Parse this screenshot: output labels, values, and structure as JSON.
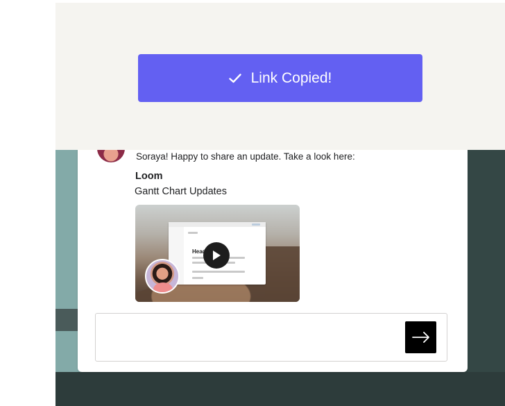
{
  "toast": {
    "icon": "check-icon",
    "label": "Link Copied!",
    "color": "#6360f2"
  },
  "message": {
    "text": "Soraya! Happy to share an update. Take a look here:",
    "attachment": {
      "source": "Loom",
      "title": "Gantt Chart Updates",
      "thumbnail": {
        "screen_heading": "Head",
        "play_icon": "play-icon"
      }
    }
  },
  "reply": {
    "value": "",
    "send_icon": "arrow-right-icon"
  }
}
